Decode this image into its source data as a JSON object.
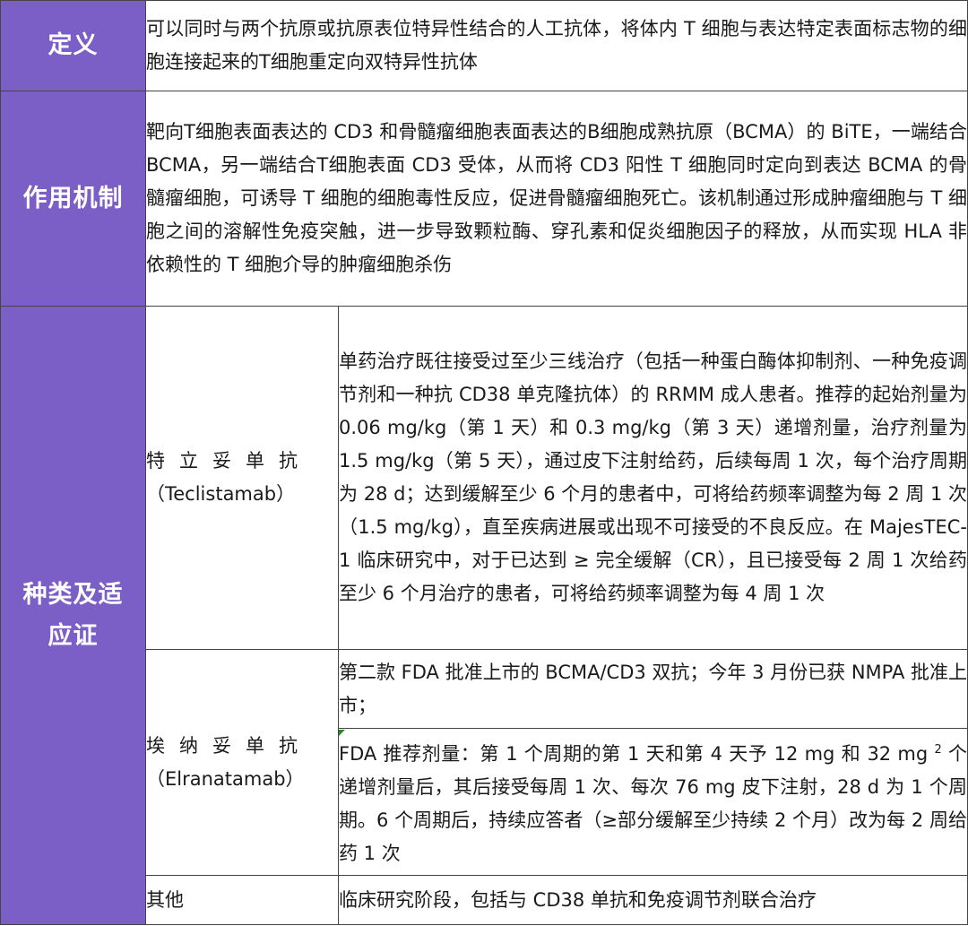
{
  "definition": {
    "label": "定义",
    "text": "可以同时与两个抗原或抗原表位特异性结合的人工抗体，将体内 T 细胞与表达特定表面标志物的细胞连接起来的T细胞重定向双特异性抗体"
  },
  "mechanism": {
    "label": "作用机制",
    "text": "靶向T细胞表面表达的 CD3 和骨髓瘤细胞表面表达的B细胞成熟抗原（BCMA）的 BiTE，一端结合 BCMA，另一端结合T细胞表面 CD3 受体，从而将 CD3 阳性 T 细胞同时定向到表达 BCMA 的骨髓瘤细胞，可诱导 T 细胞的细胞毒性反应，促进骨髓瘤细胞死亡。该机制通过形成肿瘤细胞与 T 细胞之间的溶解性免疫突触，进一步导致颗粒酶、穿孔素和促炎细胞因子的释放，从而实现 HLA 非依赖性的 T 细胞介导的肿瘤细胞杀伤"
  },
  "types": {
    "label": "种类及适应证",
    "teclistamab": {
      "name_cn": "特立妥单抗",
      "name_en": "（Teclistamab）",
      "text": "单药治疗既往接受过至少三线治疗（包括一种蛋白酶体抑制剂、一种免疫调节剂和一种抗 CD38 单克隆抗体）的 RRMM 成人患者。推荐的起始剂量为 0.06 mg/kg（第 1 天）和 0.3 mg/kg（第 3 天）递增剂量，治疗剂量为 1.5 mg/kg（第 5 天），通过皮下注射给药，后续每周 1 次，每个治疗周期为 28 d；达到缓解至少 6 个月的患者中，可将给药频率调整为每 2 周 1 次（1.5 mg/kg），直至疾病进展或出现不可接受的不良反应。在 MajesTEC-1 临床研究中，对于已达到 ≥ 完全缓解（CR），且已接受每 2 周 1 次给药至少 6 个月治疗的患者，可将给药频率调整为每 4 周 1 次"
    },
    "elranatamab": {
      "name_cn": "埃纳妥单抗",
      "name_en": "（Elranatamab）",
      "text_1": "第二款 FDA 批准上市的 BCMA/CD3 双抗；今年 3 月份已获 NMPA 批准上市；",
      "text_2_before": "FDA 推荐剂量：第 1 个周期的第 1 天和第 4 天予 12 mg 和 32 mg ",
      "text_2_sup": "2",
      "text_2_after": " 个递增剂量后，其后接受每周 1 次、每次 76 mg 皮下注射，28 d 为 1 个周期。6 个周期后，持续应答者（≥部分缓解至少持续 2 个月）改为每 2 周给药 1 次"
    },
    "other": {
      "label": "其他",
      "text": "临床研究阶段，包括与 CD38 单抗和免疫调节剂联合治疗"
    }
  },
  "colors": {
    "header_bg": "#7b5ec6",
    "header_text": "#ffffff",
    "border": "#444444"
  }
}
